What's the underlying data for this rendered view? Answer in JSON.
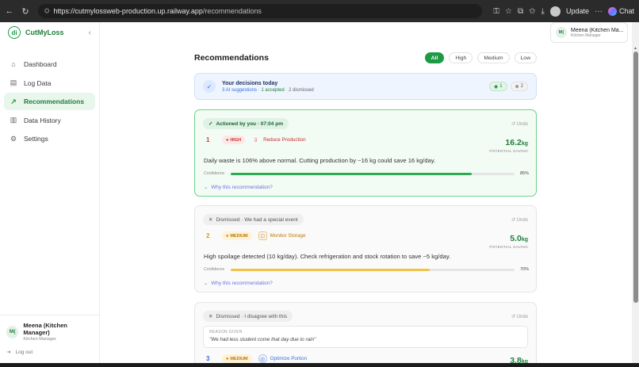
{
  "browser": {
    "url_host": "https://cutmylossweb-production.up.railway.app",
    "url_path": "/recommendations",
    "update_label": "Update",
    "more_label": "···",
    "chat_label": "Chat"
  },
  "brand": {
    "name": "CutMyLoss",
    "logo_text": "di"
  },
  "sidebar": {
    "items": [
      {
        "label": "Dashboard",
        "icon": "home-icon",
        "glyph": "⌂"
      },
      {
        "label": "Log Data",
        "icon": "clipboard-icon",
        "glyph": "▤"
      },
      {
        "label": "Recommendations",
        "icon": "trend-up-icon",
        "glyph": "↗"
      },
      {
        "label": "Data History",
        "icon": "book-icon",
        "glyph": "▥"
      },
      {
        "label": "Settings",
        "icon": "gear-icon",
        "glyph": "⚙"
      }
    ],
    "active_index": 2
  },
  "user": {
    "initials": "M(",
    "name": "Meena (Kitchen Manager)",
    "name_truncated": "Meena (Kitchen Ma...",
    "role": "Kitchen Manager",
    "logout_label": "Log out"
  },
  "page": {
    "title": "Recommendations",
    "filters": [
      "All",
      "High",
      "Medium",
      "Low"
    ],
    "active_filter": "All"
  },
  "summary": {
    "title": "Your decisions today",
    "suggestions": "3 AI suggestions",
    "sep1": " · ",
    "accepted": "1 accepted",
    "sep2": " · ",
    "dismissed": "2 dismissed",
    "accepted_badge": "1",
    "dismissed_badge": "2"
  },
  "cards": [
    {
      "status": "Actioned by you · 07:04 pm",
      "undo": "Undo",
      "rank": "1",
      "priority": "HIGH",
      "action": "Reduce Production",
      "saving_value": "16.2",
      "saving_unit": "kg",
      "saving_label": "POTENTIAL SAVING",
      "description": "Daily waste is 106% above normal. Cutting production by ~16 kg could save 16 kg/day.",
      "confidence_label": "Confidence",
      "confidence": 85,
      "confidence_text": "85%",
      "why_label": "Why this recommendation?"
    },
    {
      "status": "Dismissed · We had a special event",
      "undo": "Undo",
      "rank": "2",
      "priority": "MEDIUM",
      "action": "Monitor Storage",
      "saving_value": "5.0",
      "saving_unit": "kg",
      "saving_label": "POTENTIAL SAVING",
      "description": "High spoilage detected (10 kg/day). Check refrigeration and stock rotation to save ~5 kg/day.",
      "confidence_label": "Confidence",
      "confidence": 70,
      "confidence_text": "70%",
      "why_label": "Why this recommendation?"
    },
    {
      "status": "Dismissed · I disagree with this",
      "undo": "Undo",
      "reason_label": "REASON GIVEN",
      "reason_text": "\"We had less student come that day due to rain\"",
      "rank": "3",
      "priority": "MEDIUM",
      "action": "Optimize Portion",
      "saving_value": "3.8",
      "saving_unit": "kg"
    }
  ]
}
